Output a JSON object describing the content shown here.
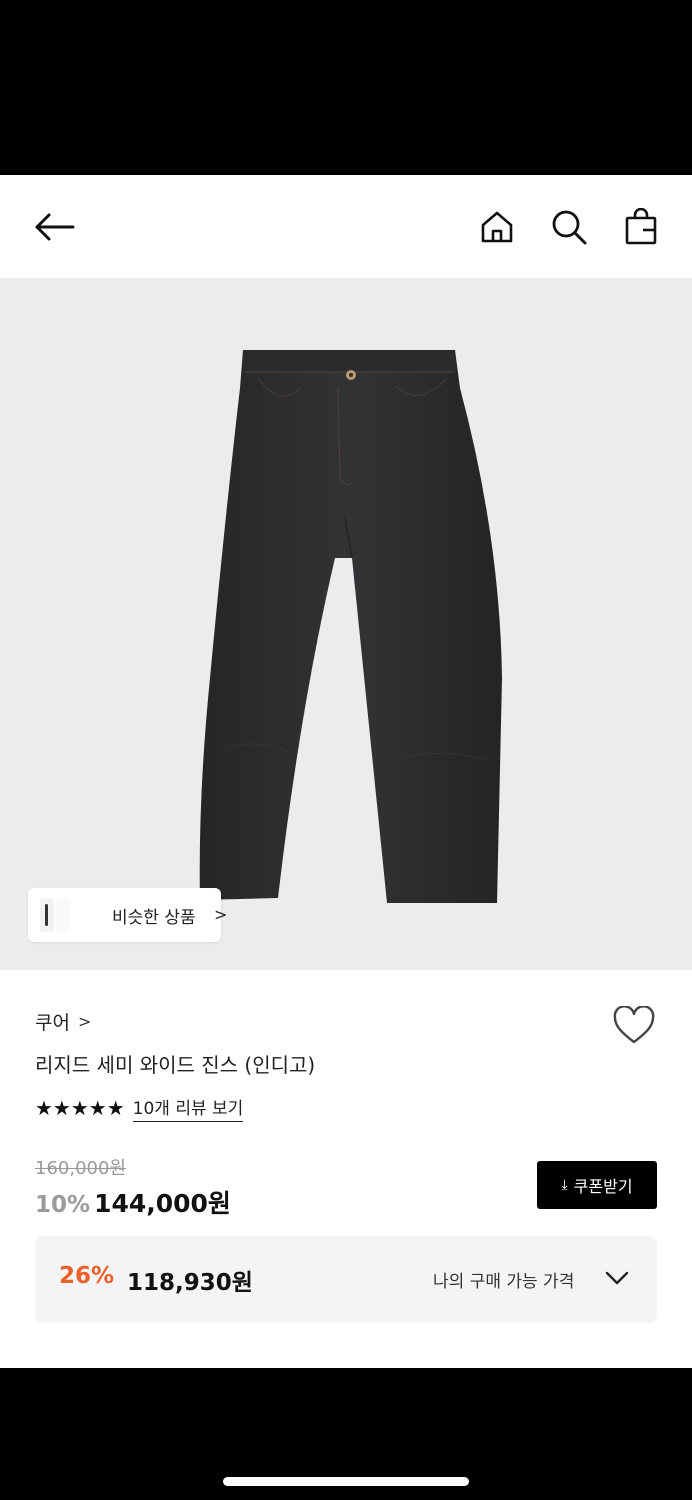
{
  "header": {
    "back_icon": "arrow-left-icon",
    "home_icon": "home-icon",
    "search_icon": "search-icon",
    "cart_icon": "shopping-bag-icon"
  },
  "hero": {
    "image": "indigo-wide-jeans",
    "similar_label": "비슷한 상품",
    "similar_arrow": ">"
  },
  "product": {
    "brand": "쿠어",
    "brand_chevron": ">",
    "title": "리지드 세미 와이드 진스 (인디고)",
    "stars": "★★★★★",
    "rating": 5,
    "review_link": "10개 리뷰 보기",
    "original_price": "160,000원",
    "discount": "10%",
    "price": "144,000원",
    "coupon_label": "쿠폰받기",
    "coupon_icon": "⤓"
  },
  "my_price": {
    "discount": "26%",
    "amount": "118,930원",
    "label": "나의 구매 가능 가격"
  },
  "colors": {
    "accent_orange": "#e9602a",
    "muted_gray": "#9a9a9a",
    "panel_bg": "#f4f4f4",
    "denim": "#2a2a2c"
  }
}
